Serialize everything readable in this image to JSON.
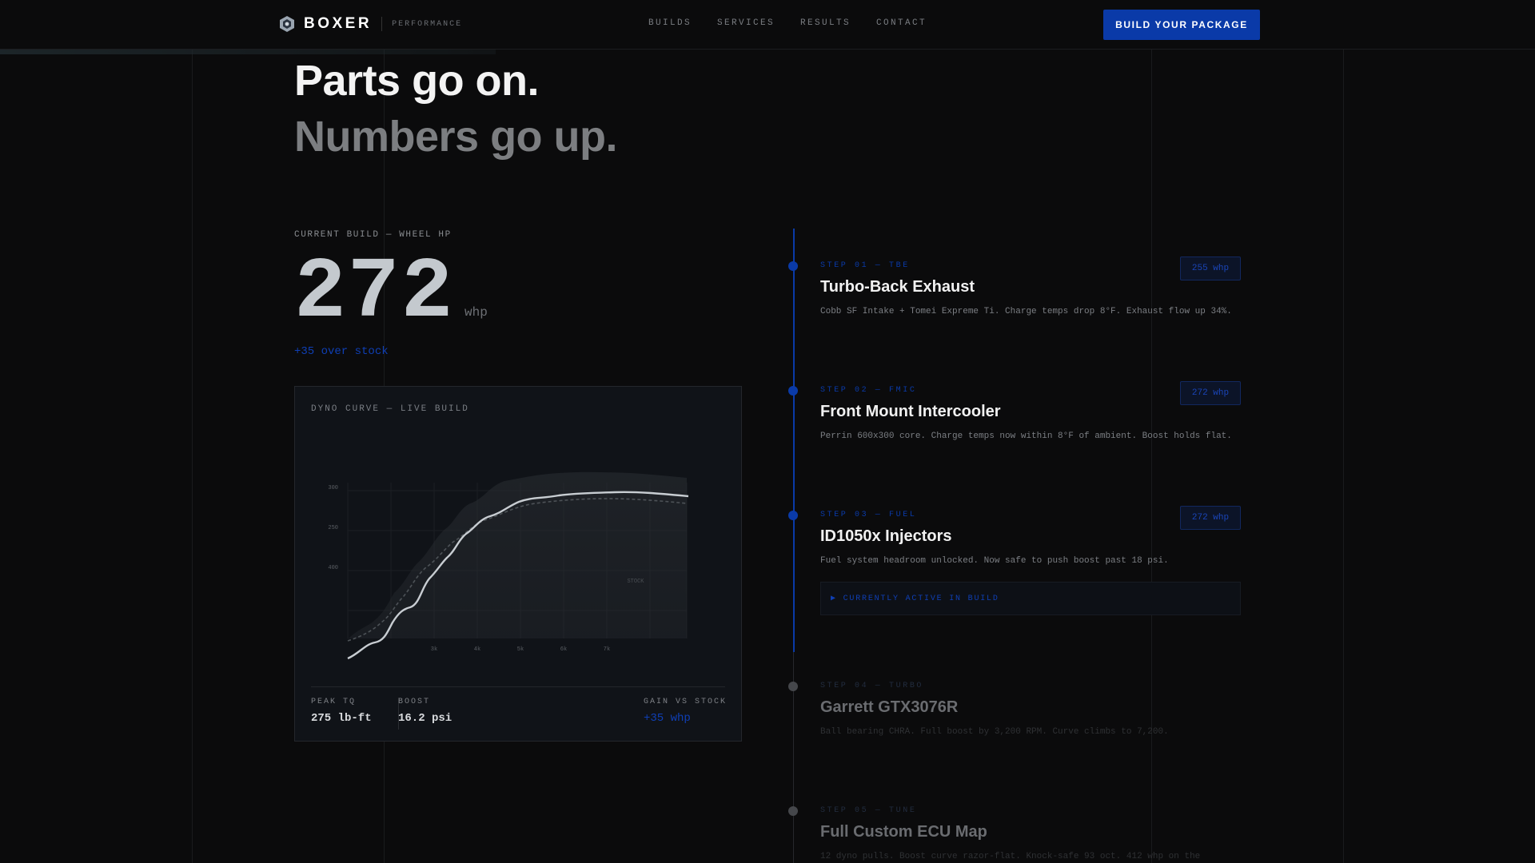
{
  "nav": {
    "brand": "BOXER",
    "brand_sub": "PERFORMANCE",
    "links": [
      "BUILDS",
      "SERVICES",
      "RESULTS",
      "CONTACT"
    ],
    "cta": "BUILD YOUR PACKAGE"
  },
  "hero": {
    "line1": "Parts go on.",
    "line2": "Numbers go up."
  },
  "build": {
    "label": "CURRENT BUILD — WHEEL HP",
    "hp": "272",
    "unit": "whp",
    "gain": "+35 over stock"
  },
  "dyno": {
    "title": "DYNO CURVE — LIVE BUILD",
    "y_ticks": [
      "300",
      "250",
      "400"
    ],
    "x_ticks": [
      "3k",
      "4k",
      "5k",
      "6k",
      "7k"
    ],
    "stock_label": "STOCK",
    "stats": [
      {
        "label": "PEAK TQ",
        "value": "275 lb-ft"
      },
      {
        "label": "BOOST",
        "value": "16.2 psi"
      },
      {
        "label": "GAIN VS STOCK",
        "value": "+35 whp"
      }
    ]
  },
  "steps": [
    {
      "tag": "STEP 01 — TBE",
      "title": "Turbo-Back Exhaust",
      "desc": "Cobb SF Intake + Tomei Expreme Ti. Charge temps drop 8°F. Exhaust flow up 34%.",
      "badge": "255 whp"
    },
    {
      "tag": "STEP 02 — FMIC",
      "title": "Front Mount Intercooler",
      "desc": "Perrin 600x300 core. Charge temps now within 8°F of ambient. Boost holds flat.",
      "badge": "272 whp"
    },
    {
      "tag": "STEP 03 — FUEL",
      "title": "ID1050x Injectors",
      "desc": "Fuel system headroom unlocked. Now safe to push boost past 18 psi.",
      "badge": "272 whp",
      "active": "▶ CURRENTLY ACTIVE IN BUILD"
    },
    {
      "tag": "STEP 04 — TURBO",
      "title": "Garrett GTX3076R",
      "desc": "Ball bearing CHRA. Full boost by 3,200 RPM. Curve climbs to 7,200."
    },
    {
      "tag": "STEP 05 — TUNE",
      "title": "Full Custom ECU Map",
      "desc": "12 dyno pulls. Boost curve razor-flat. Knock-safe 93 oct. 412 whp on the"
    }
  ],
  "colors": {
    "accent": "#0a3aa8",
    "bg": "#0b0b0c",
    "card": "#101318"
  }
}
